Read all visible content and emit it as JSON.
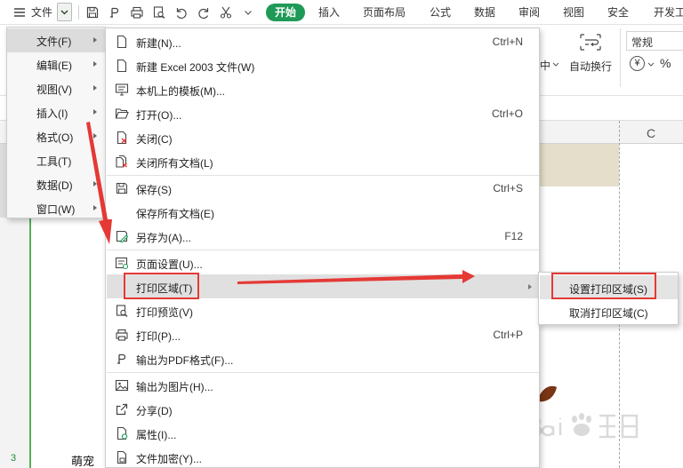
{
  "ribbon": {
    "menu_label": "文件",
    "tabs": [
      "开始",
      "插入",
      "页面布局",
      "公式",
      "数据",
      "审阅",
      "视图",
      "安全",
      "开发工"
    ],
    "wrap_text": "自动换行",
    "center_suffix": "中",
    "number_format": "常规",
    "currency_symbol": "¥",
    "percent_symbol": "%"
  },
  "sheet": {
    "column_label": "C",
    "row_label": "3",
    "cell_text": "萌宠"
  },
  "menu_bar": {
    "items": [
      {
        "label": "文件(F)"
      },
      {
        "label": "编辑(E)"
      },
      {
        "label": "视图(V)"
      },
      {
        "label": "插入(I)"
      },
      {
        "label": "格式(O)"
      },
      {
        "label": "工具(T)"
      },
      {
        "label": "数据(D)"
      },
      {
        "label": "窗口(W)"
      }
    ]
  },
  "file_menu": {
    "items": [
      {
        "label": "新建(N)...",
        "shortcut": "Ctrl+N",
        "icon": "new-document-icon"
      },
      {
        "label": "新建 Excel 2003 文件(W)",
        "shortcut": "",
        "icon": "new-excel-icon"
      },
      {
        "label": "本机上的模板(M)...",
        "shortcut": "",
        "icon": "template-icon"
      },
      {
        "label": "打开(O)...",
        "shortcut": "Ctrl+O",
        "icon": "open-folder-icon"
      },
      {
        "label": "关闭(C)",
        "shortcut": "",
        "icon": "close-document-icon"
      },
      {
        "label": "关闭所有文档(L)",
        "shortcut": "",
        "icon": "close-all-icon"
      },
      {
        "label": "保存(S)",
        "shortcut": "Ctrl+S",
        "icon": "save-icon"
      },
      {
        "label": "保存所有文档(E)",
        "shortcut": "",
        "icon": ""
      },
      {
        "label": "另存为(A)...",
        "shortcut": "F12",
        "icon": "save-as-icon"
      },
      {
        "label": "页面设置(U)...",
        "shortcut": "",
        "icon": "page-setup-icon"
      },
      {
        "label": "打印区域(T)",
        "shortcut": "",
        "icon": ""
      },
      {
        "label": "打印预览(V)",
        "shortcut": "",
        "icon": "print-preview-icon"
      },
      {
        "label": "打印(P)...",
        "shortcut": "Ctrl+P",
        "icon": "print-icon"
      },
      {
        "label": "输出为PDF格式(F)...",
        "shortcut": "",
        "icon": "pdf-export-icon"
      },
      {
        "label": "输出为图片(H)...",
        "shortcut": "",
        "icon": "image-export-icon"
      },
      {
        "label": "分享(D)",
        "shortcut": "",
        "icon": "share-icon"
      },
      {
        "label": "属性(I)...",
        "shortcut": "",
        "icon": "properties-icon"
      },
      {
        "label": "文件加密(Y)...",
        "shortcut": "",
        "icon": "encrypt-icon"
      }
    ]
  },
  "print_area_menu": {
    "items": [
      {
        "label": "设置打印区域(S)"
      },
      {
        "label": "取消打印区域(C)"
      }
    ]
  },
  "colors": {
    "accent_green": "#1e9a56",
    "annotation_red": "#e53935"
  }
}
